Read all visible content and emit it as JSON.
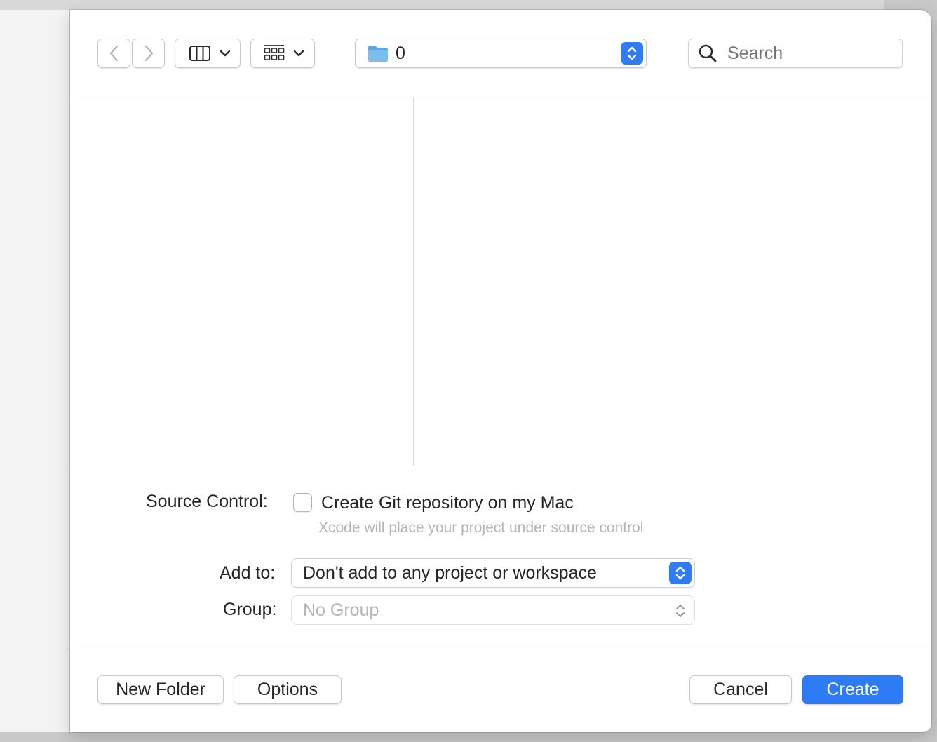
{
  "toolbar": {
    "back_icon": "chevron-left-icon",
    "forward_icon": "chevron-right-icon",
    "view_mode_icon": "columns-view-icon",
    "group_mode_icon": "grid-view-icon",
    "location": {
      "folder_icon": "folder-icon",
      "value": "0"
    },
    "search": {
      "icon": "magnifier-icon",
      "placeholder": "Search"
    }
  },
  "form": {
    "source_control": {
      "label": "Source Control:",
      "checkbox_label": "Create Git repository on my Mac",
      "checked": false,
      "hint": "Xcode will place your project under source control"
    },
    "add_to": {
      "label": "Add to:",
      "value": "Don't add to any project or workspace"
    },
    "group": {
      "label": "Group:",
      "value": "No Group"
    }
  },
  "footer": {
    "new_folder_label": "New Folder",
    "options_label": "Options",
    "cancel_label": "Cancel",
    "create_label": "Create"
  },
  "colors": {
    "accent": "#2d7cf6",
    "folder": "#6fb3ea"
  }
}
